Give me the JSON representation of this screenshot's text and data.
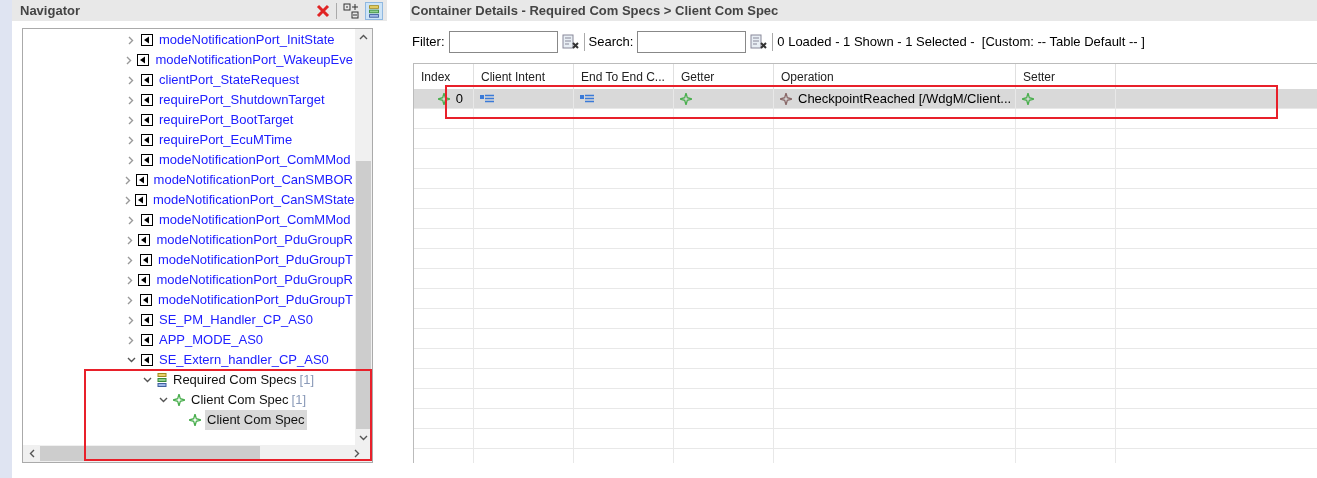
{
  "navigator": {
    "title": "Navigator",
    "tree": [
      {
        "label": "modeNotificationPort_InitState",
        "kind": "port",
        "expanded": false
      },
      {
        "label": "modeNotificationPort_WakeupEve",
        "kind": "port",
        "expanded": false
      },
      {
        "label": "clientPort_StateRequest",
        "kind": "port",
        "expanded": false
      },
      {
        "label": "requirePort_ShutdownTarget",
        "kind": "port",
        "expanded": false
      },
      {
        "label": "requirePort_BootTarget",
        "kind": "port",
        "expanded": false
      },
      {
        "label": "requirePort_EcuMTime",
        "kind": "port",
        "expanded": false
      },
      {
        "label": "modeNotificationPort_ComMMod",
        "kind": "port",
        "expanded": false
      },
      {
        "label": "modeNotificationPort_CanSMBOR",
        "kind": "port",
        "expanded": false
      },
      {
        "label": "modeNotificationPort_CanSMState",
        "kind": "port",
        "expanded": false
      },
      {
        "label": "modeNotificationPort_ComMMod",
        "kind": "port",
        "expanded": false
      },
      {
        "label": "modeNotificationPort_PduGroupR",
        "kind": "port",
        "expanded": false
      },
      {
        "label": "modeNotificationPort_PduGroupT",
        "kind": "port",
        "expanded": false
      },
      {
        "label": "modeNotificationPort_PduGroupR",
        "kind": "port",
        "expanded": false
      },
      {
        "label": "modeNotificationPort_PduGroupT",
        "kind": "port",
        "expanded": false
      },
      {
        "label": "SE_PM_Handler_CP_AS0",
        "kind": "port",
        "expanded": false
      },
      {
        "label": "APP_MODE_AS0",
        "kind": "port",
        "expanded": false
      },
      {
        "label": "SE_Extern_handler_CP_AS0",
        "kind": "port",
        "expanded": true,
        "children": [
          {
            "label": "Required Com Specs",
            "count": "[1]",
            "kind": "container",
            "expanded": true,
            "children": [
              {
                "label": "Client Com Spec",
                "count": "[1]",
                "kind": "spec",
                "expanded": true,
                "children": [
                  {
                    "label": "Client Com Spec",
                    "kind": "spec",
                    "selected": true
                  }
                ]
              }
            ]
          }
        ]
      }
    ]
  },
  "details": {
    "title": "Container Details - Required Com Specs > Client Com Spec",
    "filter_label": "Filter:",
    "search_label": "Search:",
    "status": "0 Loaded - 1 Shown - 1 Selected -  [Custom: -- Table Default -- ]",
    "table": {
      "columns": [
        "Index",
        "Client Intent",
        "End To End C...",
        "Getter",
        "Operation",
        "Setter"
      ],
      "rows": [
        {
          "selected": true,
          "index": "0",
          "operation": "CheckpointReached [/WdgM/Client..."
        }
      ]
    }
  }
}
